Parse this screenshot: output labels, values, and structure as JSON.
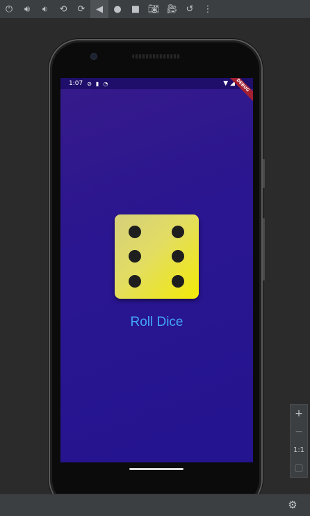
{
  "toolbar": {
    "items": [
      {
        "icon": "power-icon",
        "glyph": "⏻"
      },
      {
        "icon": "volume-up-icon",
        "glyph": "🔊︎"
      },
      {
        "icon": "volume-down-icon",
        "glyph": "🔉︎"
      },
      {
        "icon": "rotate-left-icon",
        "glyph": "⟲"
      },
      {
        "icon": "rotate-right-icon",
        "glyph": "⟳"
      },
      {
        "icon": "back-icon",
        "glyph": "◀"
      },
      {
        "icon": "home-icon",
        "glyph": "●"
      },
      {
        "icon": "overview-icon",
        "glyph": "■"
      },
      {
        "icon": "camera-icon",
        "glyph": "📷︎"
      },
      {
        "icon": "record-icon",
        "glyph": "🎥︎"
      },
      {
        "icon": "replay-icon",
        "glyph": "↺"
      },
      {
        "icon": "more-icon",
        "glyph": "⋮"
      }
    ]
  },
  "statusbar": {
    "time": "1:07",
    "left_icons": [
      "⊘",
      "▮",
      "◔"
    ],
    "wifi": "▼",
    "signal": "◢",
    "battery": "▮"
  },
  "app": {
    "debug_banner": "DEBUG",
    "dice_value": 6,
    "roll_label": "Roll Dice"
  },
  "zoom": {
    "zoom_in": "+",
    "zoom_out": "−",
    "actual_size": "1:1",
    "fit": "▢"
  },
  "bottombar": {
    "settings_glyph": "⚙"
  },
  "colors": {
    "screen_bg": "#2a1690",
    "dice_face": "#e2dd62",
    "pip": "#1e1e1e",
    "roll_label": "#43a6f5",
    "debug_banner": "#a32032"
  }
}
